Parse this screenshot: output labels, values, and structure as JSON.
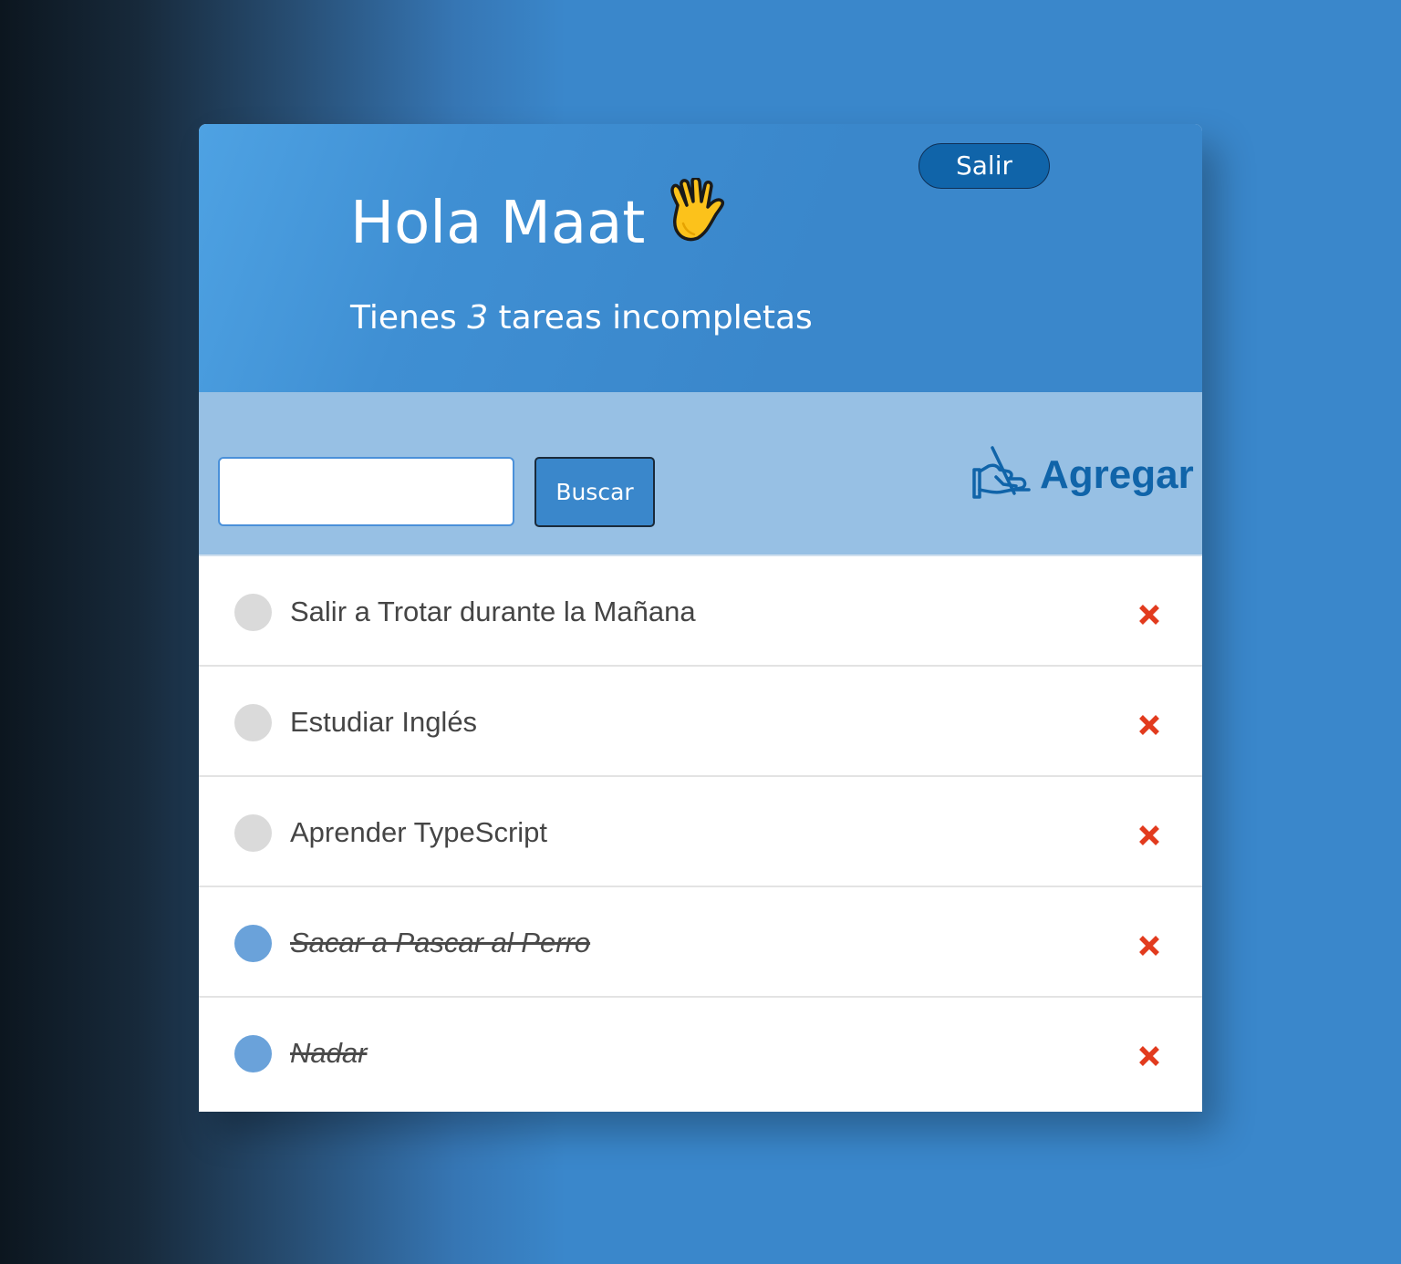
{
  "header": {
    "logout_label": "Salir",
    "greeting": "Hola Maat",
    "greeting_icon": "waving-hand-icon",
    "subtitle_before": "Tienes ",
    "incomplete_count": "3",
    "subtitle_after": " tareas incompletas"
  },
  "toolbar": {
    "search_value": "",
    "search_label": "Buscar",
    "add_label": "Agregar",
    "add_icon": "writing-hand-icon"
  },
  "tasks": [
    {
      "text": "Salir a Trotar durante la Mañana",
      "completed": false
    },
    {
      "text": "Estudiar Inglés",
      "completed": false
    },
    {
      "text": "Aprender TypeScript",
      "completed": false
    },
    {
      "text": "Sacar a Pascar al Perro",
      "completed": true
    },
    {
      "text": "Nadar",
      "completed": true
    }
  ],
  "colors": {
    "header_blue": "#3a87cb",
    "toolbar_blue": "#97c0e4",
    "accent_dark_blue": "#1064a9",
    "completed_check": "#6aa2da",
    "pending_check": "#dadada",
    "delete_red": "#e23b1e"
  }
}
